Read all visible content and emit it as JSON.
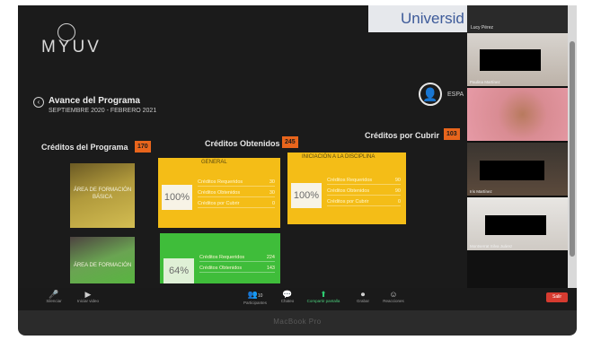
{
  "bezel_label": "MacBook Pro",
  "university_banner": "Universid",
  "app": {
    "logo_text": "MYUV",
    "program_title": "Avance del Programa",
    "program_period": "SEPTIEMBRE 2020 - FEBRERO 2021",
    "profile_label": "ESPA",
    "credits_program": {
      "label": "Créditos del Programa",
      "value": "170"
    },
    "credits_obtained": {
      "label": "Créditos Obtenidos",
      "value": "245"
    },
    "credits_pending": {
      "label": "Créditos por Cubrir",
      "value": "103"
    },
    "area_cards": [
      {
        "text": "ÁREA DE FORMACIÓN BÁSICA"
      },
      {
        "text": "ÁREA DE FORMACIÓN"
      }
    ],
    "panels": [
      {
        "header": "GENERAL",
        "percent": "100%",
        "rows": [
          {
            "label": "Créditos Requeridos",
            "value": "30"
          },
          {
            "label": "Créditos Obtenidos",
            "value": "30"
          },
          {
            "label": "Créditos por Cubrir",
            "value": "0"
          }
        ]
      },
      {
        "header": "INICIACIÓN A LA DISCIPLINA",
        "percent": "100%",
        "rows": [
          {
            "label": "Créditos Requeridos",
            "value": "90"
          },
          {
            "label": "Créditos Obtenidos",
            "value": "90"
          },
          {
            "label": "Créditos por Cubrir",
            "value": "0"
          }
        ]
      },
      {
        "header": "",
        "percent": "64%",
        "rows": [
          {
            "label": "Créditos Requeridos",
            "value": "224"
          },
          {
            "label": "Créditos Obtenidos",
            "value": "143"
          }
        ]
      }
    ]
  },
  "toolbar": {
    "items": [
      {
        "icon": "🎤",
        "label": "Silenciar"
      },
      {
        "icon": "▶",
        "label": "Iniciar video"
      },
      {
        "icon": "👥",
        "label": "Participantes",
        "count": "10"
      },
      {
        "icon": "💬",
        "label": "Chateo"
      },
      {
        "icon": "⬆",
        "label": "Compartir pantalla"
      },
      {
        "icon": "⏺",
        "label": "Grabar"
      },
      {
        "icon": "☺",
        "label": "Reacciones"
      }
    ],
    "end_label": "Salir"
  },
  "gallery": {
    "top_name": "Lucy Pérez",
    "tiles": [
      {
        "name": "Paulina Martínez"
      },
      {
        "name": ""
      },
      {
        "name": "Iris Martínez"
      },
      {
        "name": "Montserrat Silva Juárez"
      }
    ]
  },
  "colors": {
    "accent_orange": "#e8651c",
    "panel_yellow": "#f4bd17",
    "panel_green": "#3fbd3a",
    "share_green": "#2ecc71",
    "end_red": "#d63b30"
  }
}
